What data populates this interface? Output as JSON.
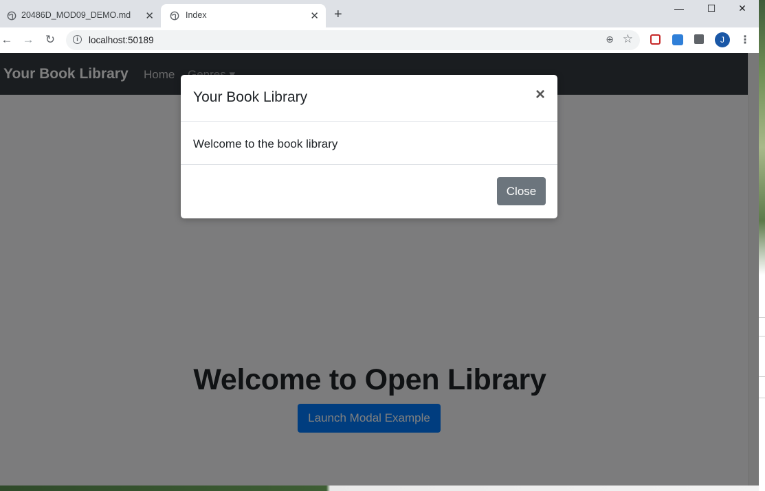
{
  "browser": {
    "tabs": [
      {
        "title": "20486D_MOD09_DEMO.md",
        "close": "✕"
      },
      {
        "title": "Index",
        "close": "✕"
      }
    ],
    "new_tab": "+",
    "window": {
      "minimize": "—",
      "maximize": "☐",
      "close": "✕"
    },
    "address": "localhost:50189",
    "profile_initial": "J"
  },
  "navbar": {
    "brand": "Your Book Library",
    "items": [
      "Home",
      "Genres ▾"
    ]
  },
  "main": {
    "heading": "Welcome to Open Library",
    "launch_button": "Launch Modal Example"
  },
  "modal": {
    "title": "Your Book Library",
    "close_x": "×",
    "body": "Welcome to the book library",
    "close_button": "Close"
  },
  "colors": {
    "navbar_bg": "#343a40",
    "primary": "#007bff",
    "secondary": "#6c757d",
    "backdrop": "rgba(0,0,0,0.5)"
  }
}
